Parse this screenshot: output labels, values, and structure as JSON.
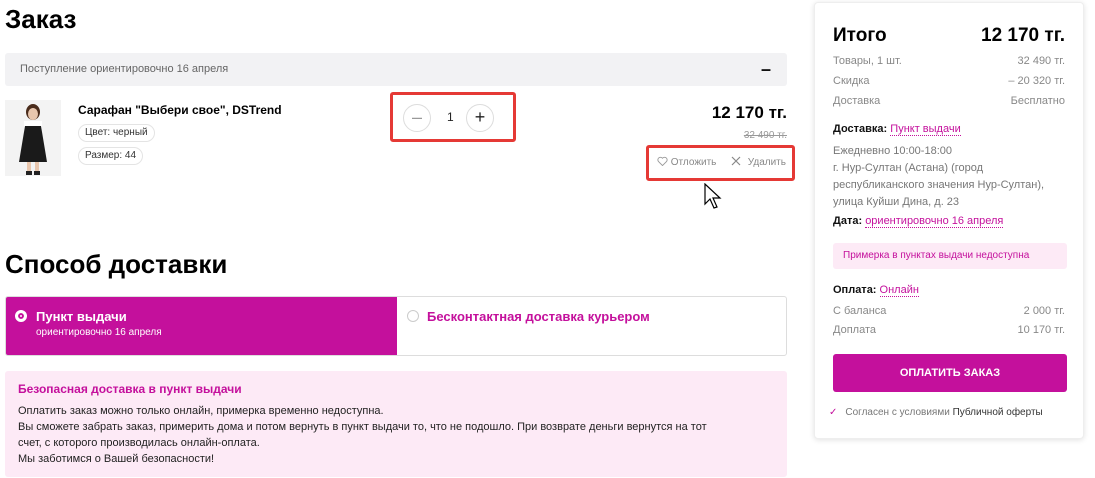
{
  "order": {
    "title": "Заказ",
    "delivery_eta": "Поступление ориентировочно 16 апреля",
    "collapse_symbol": "–",
    "product": {
      "name": "Сарафан \"Выбери свое\", DSTrend",
      "color": "Цвет: черный",
      "size": "Размер: 44",
      "quantity": "1",
      "qty_minus": "–",
      "qty_plus": "+",
      "price": "12 170 тг.",
      "old_price": "32 490 тг.",
      "postpone_label": "Отложить",
      "delete_label": "Удалить"
    }
  },
  "shipping": {
    "title": "Способ доставки",
    "pickup": {
      "label": "Пункт выдачи",
      "sub": "ориентировочно 16 апреля"
    },
    "courier": {
      "label": "Бесконтактная доставка курьером"
    },
    "notice": {
      "title": "Безопасная доставка в пункт выдачи",
      "lines": [
        "Оплатить заказ можно только онлайн, примерка временно недоступна.",
        "Вы сможете забрать заказ, примерить дома и потом вернуть в пункт выдачи то, что не подошло. При возврате деньги вернутся на тот",
        "счет, с которого производилась онлайн-оплата.",
        "Мы заботимся о Вашей безопасности!"
      ]
    }
  },
  "summary": {
    "title": "Итого",
    "total": "12 170 тг.",
    "rows": [
      {
        "label": "Товары, 1 шт.",
        "value": "32 490 тг."
      },
      {
        "label": "Скидка",
        "value": "– 20 320 тг."
      },
      {
        "label": "Доставка",
        "value": "Бесплатно"
      }
    ],
    "delivery_label": "Доставка:",
    "delivery_link": "Пункт выдачи",
    "hours": "Ежедневно 10:00-18:00",
    "address_lines": [
      "г. Нур-Султан (Астана) (город",
      "республиканского значения Нур-Султан),",
      "улица Куйши Дина, д. 23"
    ],
    "date_label": "Дата:",
    "date_link": "ориентировочно 16 апреля",
    "fitting_warning": "Примерка в пунктах выдачи недоступна",
    "payment_label": "Оплата:",
    "payment_link": "Онлайн",
    "balance_rows": [
      {
        "label": "С баланса",
        "value": "2 000 тг."
      },
      {
        "label": "Доплата",
        "value": "10 170 тг."
      }
    ],
    "pay_button": "ОПЛАТИТЬ ЗАКАЗ",
    "agree_check": "✓",
    "agree_text": "Согласен с условиями ",
    "agree_link": "Публичной оферты"
  },
  "colors": {
    "accent": "#c4109c",
    "highlight": "#e53935",
    "notice_bg": "#fdeaf6"
  },
  "icons": [
    "heart-icon",
    "close-icon",
    "mouse-cursor-icon"
  ]
}
